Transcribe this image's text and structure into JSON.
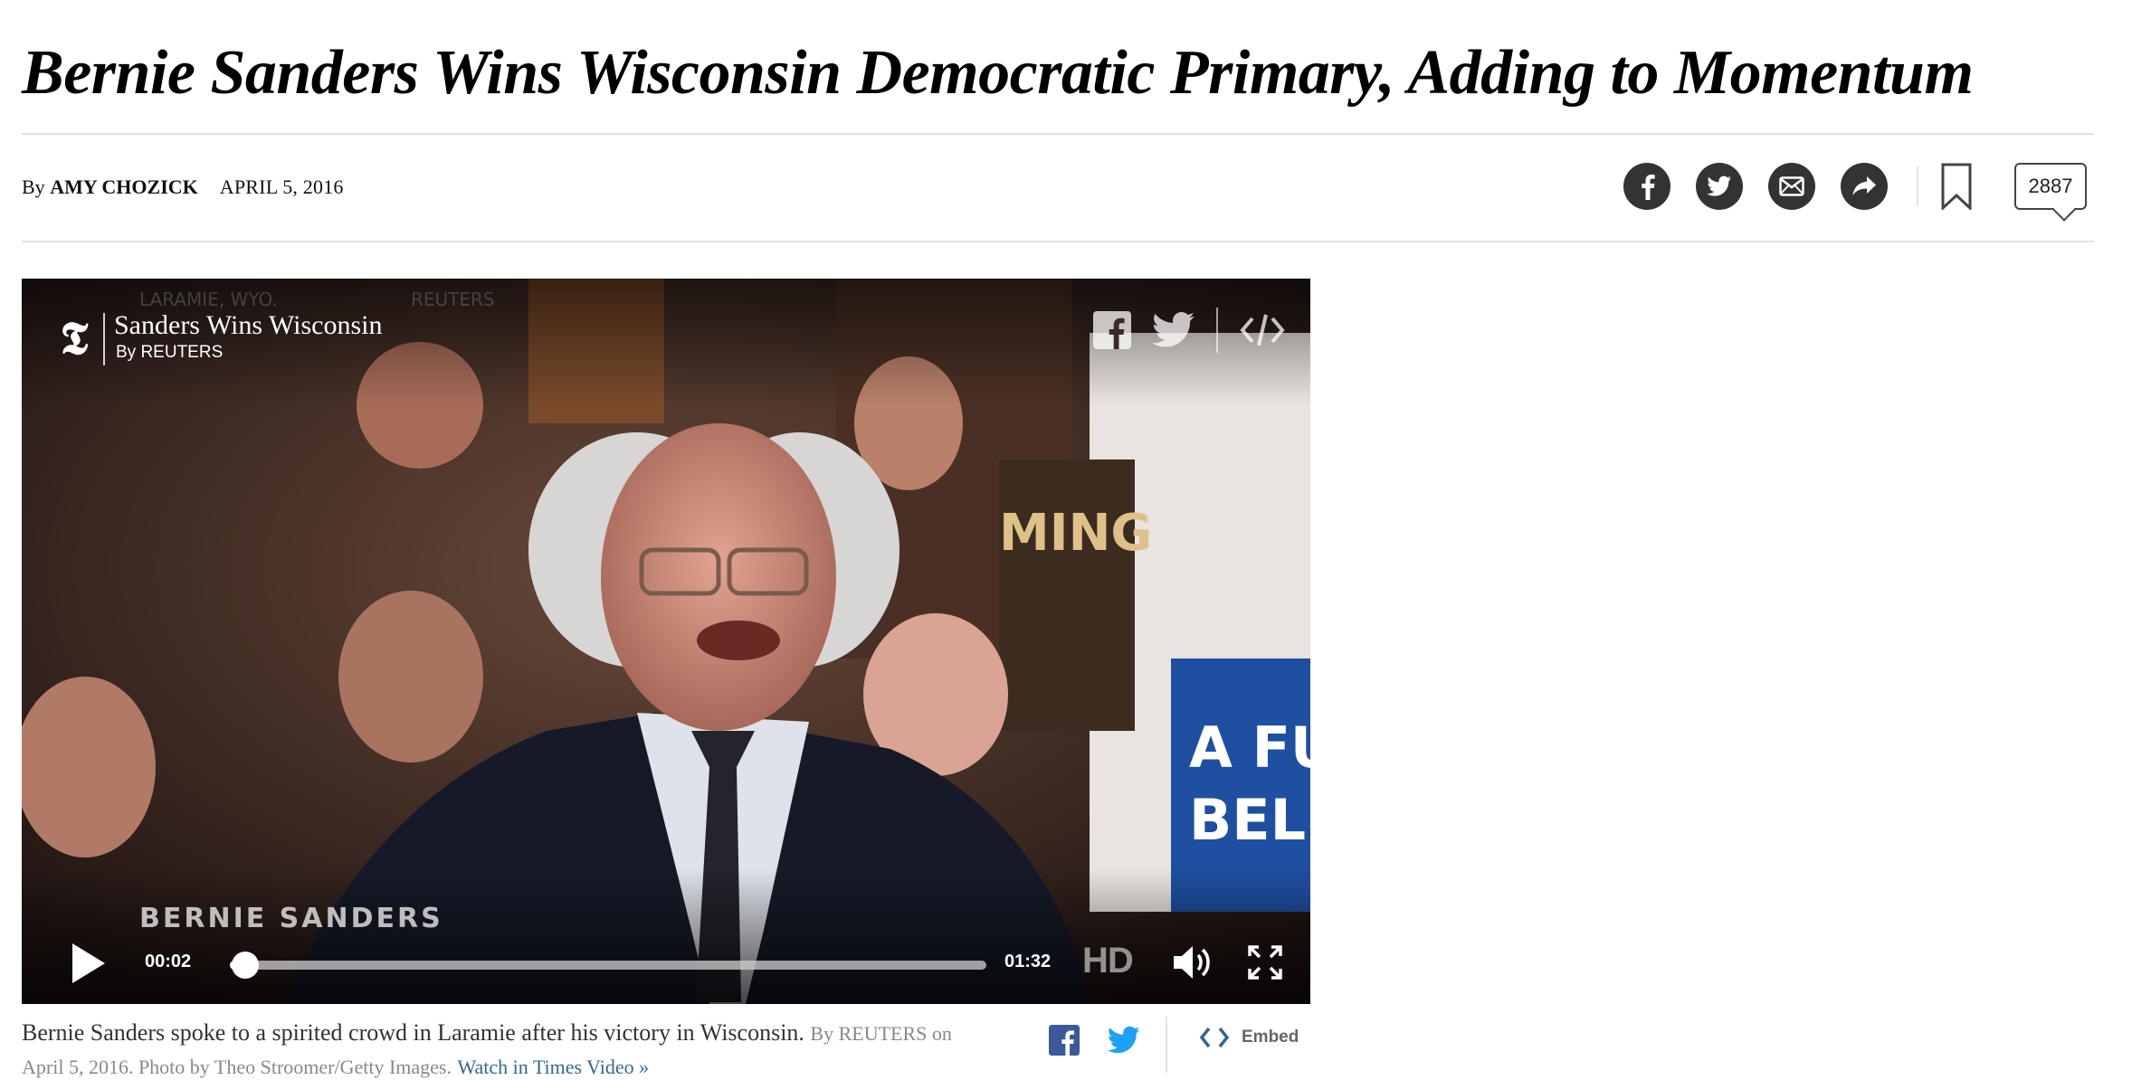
{
  "article": {
    "headline": "Bernie Sanders Wins Wisconsin Democratic Primary, Adding to Momentum",
    "byline_prefix": "By ",
    "author": "AMY CHOZICK",
    "date": "APRIL 5, 2016"
  },
  "share_tools": {
    "items": [
      {
        "icon": "facebook-icon"
      },
      {
        "icon": "twitter-icon"
      },
      {
        "icon": "email-icon"
      },
      {
        "icon": "share-arrow-icon"
      }
    ],
    "save_icon": "bookmark-icon",
    "comment_count": "2887"
  },
  "video": {
    "title": "Sanders Wins Wisconsin",
    "byline": "By REUTERS",
    "lower_third": "BERNIE SANDERS",
    "current_time": "00:02",
    "duration": "01:32",
    "progress": 0.02,
    "hd_label": "HD",
    "icons": [
      "play-icon",
      "volume-icon",
      "fullscreen-icon",
      "facebook-icon",
      "twitter-icon",
      "embed-icon",
      "nyt-t-logo-icon"
    ]
  },
  "caption": {
    "text": "Bernie Sanders spoke to a spirited crowd in Laramie after his victory in Wisconsin.",
    "credit": "By REUTERS on April 5, 2016. Photo by Theo Stroomer/Getty Images.",
    "link": "Watch in Times Video »",
    "embed_label": "Embed"
  },
  "colors": {
    "link": "#326891",
    "facebook": "#3b5998",
    "twitter": "#1da1f2",
    "share_button": "#333333"
  }
}
